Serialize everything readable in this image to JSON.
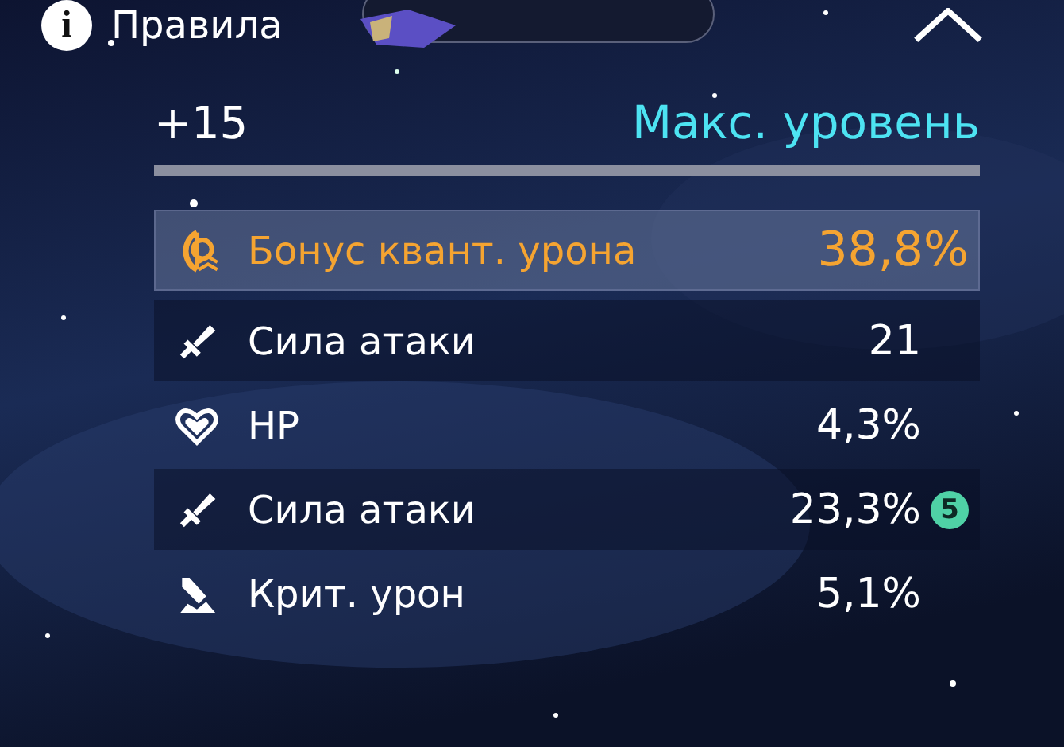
{
  "top_bar": {
    "info": "i",
    "rules": "Правила"
  },
  "header": {
    "level": "+15",
    "status": "Макс. уровень"
  },
  "progress": {
    "level": 1
  },
  "stats": [
    {
      "kind": "quantum",
      "highlighted": true,
      "name": "Бонус квант. урона",
      "value": "38,8%"
    },
    {
      "kind": "attack",
      "highlighted": false,
      "name": "Сила атаки",
      "value": "21"
    },
    {
      "kind": "hp",
      "highlighted": false,
      "name": "HP",
      "value": "4,3%"
    },
    {
      "kind": "attack",
      "highlighted": false,
      "name": "Сила атаки",
      "value": "23,3%",
      "badge": "5"
    },
    {
      "kind": "crit",
      "highlighted": false,
      "name": "Крит. урон",
      "value": "5,1%"
    }
  ]
}
